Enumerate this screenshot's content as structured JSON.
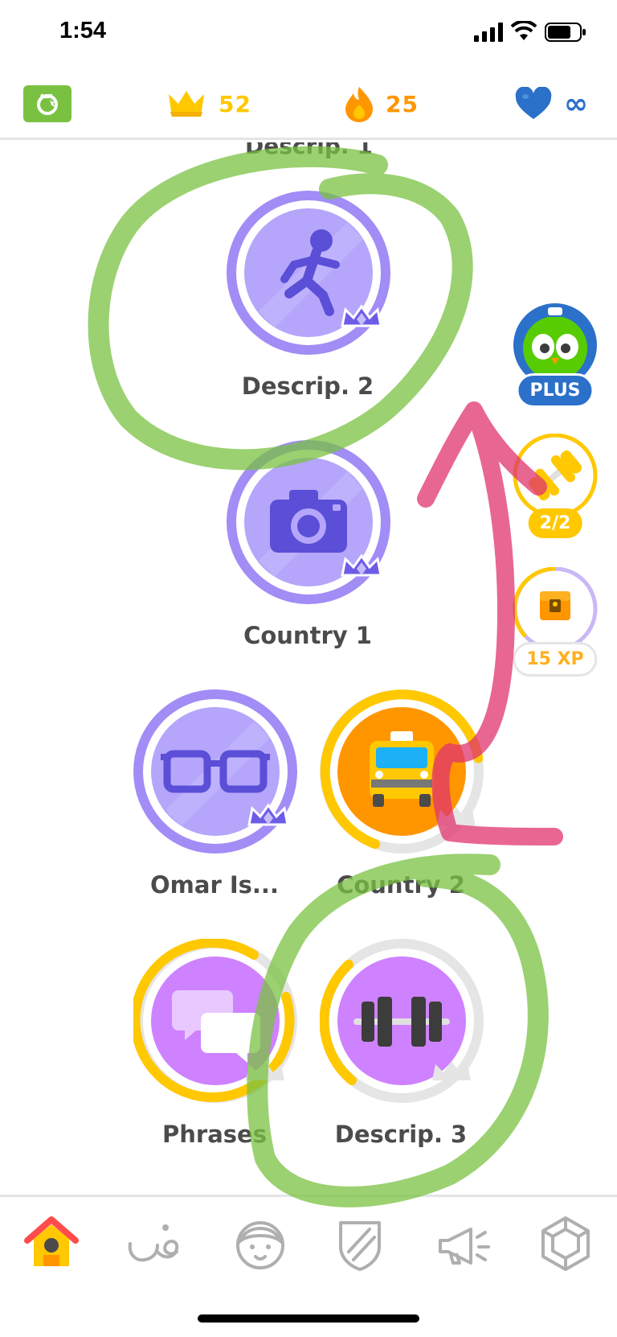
{
  "status_bar": {
    "time": "1:54"
  },
  "header": {
    "crowns": "52",
    "streak": "25",
    "hearts": "∞"
  },
  "path": {
    "partial_label": "Descrip. 1",
    "skills": [
      {
        "label": "Descrip. 2",
        "state": "legendary",
        "icon": "running-person-icon"
      },
      {
        "label": "Country 1",
        "state": "legendary",
        "icon": "camera-icon"
      },
      {
        "label": "Omar Is...",
        "state": "legendary",
        "icon": "glasses-icon"
      },
      {
        "label": "Country 2",
        "state": "in-progress",
        "icon": "taxi-icon"
      },
      {
        "label": "Phrases",
        "state": "in-progress",
        "icon": "speech-bubbles-icon"
      },
      {
        "label": "Descrip. 3",
        "state": "in-progress",
        "icon": "dumbbell-icon"
      }
    ]
  },
  "side": {
    "plus_label": "PLUS",
    "practice_label": "2/2",
    "chest_label": "15 XP"
  },
  "colors": {
    "legendary": "#a18df5",
    "gold": "#ffc800",
    "purple_skill": "#ce82ff",
    "orange_skill": "#ff9600",
    "annotation_green": "#7ac142",
    "annotation_pink": "#e0336e"
  },
  "nav": [
    "home-icon",
    "letters-icon",
    "characters-icon",
    "leagues-shield-icon",
    "news-megaphone-icon",
    "shop-gem-icon"
  ]
}
